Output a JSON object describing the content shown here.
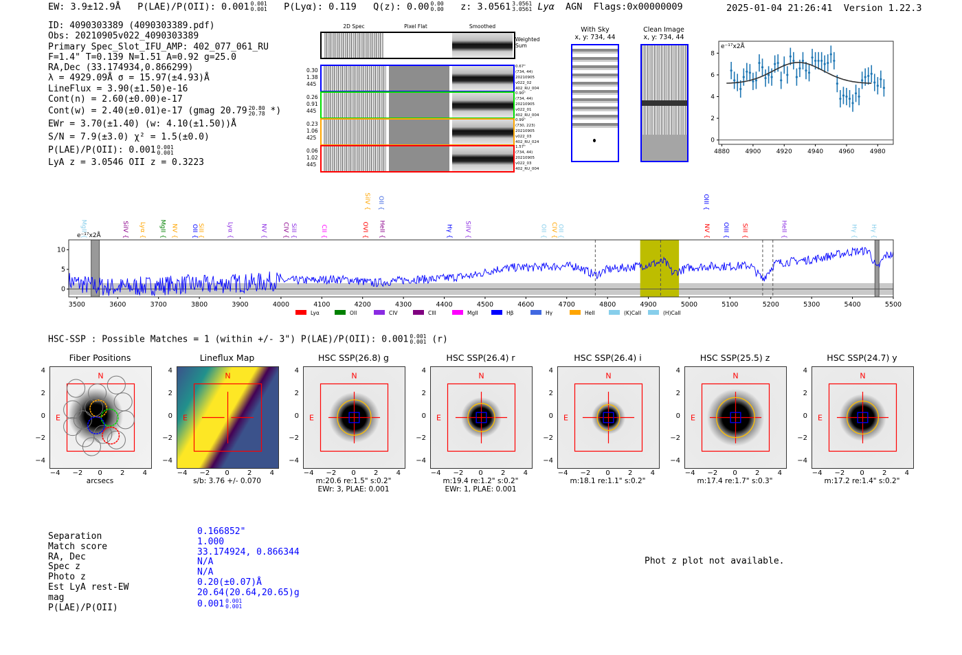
{
  "header": {
    "ew": "EW: 3.9±12.9Å",
    "plae_label": "P(LAE)/P(OII): 0.001",
    "plae_hi": "0.001",
    "plae_lo": "0.001",
    "plya": "P(Lyα): 0.119",
    "qz_label": "Q(z): 0.00",
    "qz_hi": "0.00",
    "qz_lo": "0.00",
    "z_label": "z: 3.0561",
    "z_hi": "3.0561",
    "z_lo": "3.0561",
    "line": "Lyα",
    "agn": "AGN",
    "flags": "Flags:0x00000009",
    "datetime": "2025-01-04 21:26:41",
    "version": "Version 1.22.3"
  },
  "info": {
    "lines": [
      "ID: 4090303389 (4090303389.pdf)",
      "Obs: 20210905v022_4090303389",
      "Primary Spec_Slot_IFU_AMP: 402_077_061_RU",
      "F=1.4\"  T=0.139  N=1.51  A=0.92  g=25.0",
      "RA,Dec (33.174934,0.866299)",
      "λ = 4929.09Å   σ = 15.97(±4.93)Å",
      "LineFlux = 3.90(±1.50)e-16",
      "Cont(n) = 2.60(±0.00)e-17"
    ],
    "contw": "Cont(w) = 2.40(±0.01)e-17 (gmag 20.79",
    "contw_hi": "20.80",
    "contw_lo": "20.78",
    "contw_end": "*)",
    "ewr": "EWr = 3.70(±1.40) (w: 4.10(±1.50))Å",
    "sn": "S/N = 7.9(±3.0)  χ² = 1.5(±0.0)",
    "plae": "P(LAE)/P(OII): 0.001",
    "plae_hi": "0.001",
    "plae_lo": "0.001",
    "z": "LyA z = 3.0546   OII z = 0.3223"
  },
  "spec2d": {
    "col_titles": [
      "2D Spec",
      "Pixel Flat",
      "Smoothed"
    ],
    "weighted_label": "Weighted Sum",
    "rows": [
      {
        "color": "#0000ff",
        "left": [
          "0.30",
          "1.38",
          "445"
        ],
        "right": [
          "0.67\"",
          "(734, 44)",
          "20210905",
          "v022_02",
          "402_RU_004"
        ]
      },
      {
        "color": "#00dd00",
        "left": [
          "0.26",
          "0.91",
          "445"
        ],
        "right": [
          "0.90\"",
          "(734, 44)",
          "20210905",
          "v022_01",
          "402_RU_004"
        ]
      },
      {
        "color": "#ffa500",
        "left": [
          "0.23",
          "1.06",
          "425"
        ],
        "right": [
          "0.99\"",
          "(730, 223)",
          "20210905",
          "v022_03",
          "402_RU_024"
        ]
      },
      {
        "color": "#ff0000",
        "left": [
          "0.06",
          "1.02",
          "445"
        ],
        "right": [
          "1.57\"",
          "(734, 44)",
          "20210905",
          "v022_03",
          "402_RU_004"
        ]
      }
    ]
  },
  "sky": {
    "title1": "With Sky",
    "coords1": "x, y: 734, 44",
    "title2": "Clean Image",
    "coords2": "x, y: 734, 44"
  },
  "chart_data": [
    {
      "type": "scatter",
      "unit_label": "e⁻¹⁷x2Å",
      "xlim": [
        4878,
        4990
      ],
      "ylim": [
        -0.4,
        9.1
      ],
      "xticks": [
        4880,
        4900,
        4920,
        4940,
        4960,
        4980
      ],
      "yticks": [
        0,
        2,
        4,
        6,
        8
      ],
      "x": [
        4886,
        4888,
        4890,
        4892,
        4894,
        4896,
        4898,
        4900,
        4902,
        4904,
        4906,
        4908,
        4910,
        4912,
        4914,
        4916,
        4918,
        4920,
        4922,
        4924,
        4926,
        4928,
        4930,
        4932,
        4934,
        4936,
        4938,
        4940,
        4942,
        4944,
        4946,
        4948,
        4950,
        4952,
        4954,
        4956,
        4958,
        4960,
        4962,
        4964,
        4966,
        4968,
        4970,
        4972,
        4974,
        4976,
        4978,
        4980,
        4982,
        4984
      ],
      "y": [
        6.4,
        5.5,
        5.3,
        4.7,
        5.8,
        6.3,
        6.2,
        5.4,
        5.5,
        7.1,
        6.7,
        5.7,
        6.0,
        5.8,
        7.0,
        7.1,
        5.5,
        6.9,
        6.0,
        7.7,
        7.3,
        5.8,
        6.6,
        7.3,
        6.4,
        6.2,
        7.6,
        7.3,
        7.3,
        7.3,
        7.0,
        7.1,
        7.9,
        7.3,
        5.2,
        3.8,
        4.1,
        4.0,
        3.8,
        3.4,
        4.3,
        4.0,
        5.5,
        5.8,
        5.9,
        6.1,
        5.3,
        5.0,
        5.6,
        4.8
      ],
      "yerr": 0.8,
      "fit": {
        "model": "gaussian",
        "center": 4929.09,
        "sigma": 15.97,
        "continuum": 5.2,
        "amplitude": 1.95,
        "range": [
          4883,
          4976
        ]
      },
      "colors": {
        "points": "#1f77b4",
        "fit": "#333333"
      }
    },
    {
      "type": "line",
      "unit_label": "e⁻¹⁷x2Å",
      "xlim": [
        3480,
        5500
      ],
      "ylim": [
        -2,
        12.5
      ],
      "xticks": [
        3500,
        3600,
        3700,
        3800,
        3900,
        4000,
        4100,
        4200,
        4300,
        4400,
        4500,
        4600,
        4700,
        4800,
        4900,
        5000,
        5100,
        5200,
        5300,
        5400,
        5500
      ],
      "yticks": [
        0,
        5,
        10
      ],
      "x": [
        3480,
        3525,
        3575,
        3625,
        3675,
        3725,
        3775,
        3825,
        3875,
        3925,
        3975,
        4025,
        4075,
        4125,
        4175,
        4225,
        4275,
        4325,
        4375,
        4425,
        4475,
        4525,
        4575,
        4625,
        4675,
        4725,
        4770,
        4800,
        4850,
        4900,
        4940,
        4960,
        5000,
        5050,
        5100,
        5150,
        5180,
        5210,
        5250,
        5300,
        5350,
        5400,
        5440,
        5460,
        5480,
        5500
      ],
      "y": [
        2,
        1,
        0.5,
        0.5,
        0.8,
        1,
        1.2,
        1,
        1.5,
        1.5,
        2,
        2.2,
        2.2,
        2.5,
        2.3,
        1.5,
        2,
        2.5,
        2.5,
        3,
        3.5,
        5,
        5.5,
        5.5,
        5.8,
        5.8,
        3.5,
        5,
        5.5,
        6.2,
        7,
        4,
        5.5,
        5.8,
        5.8,
        6,
        2.5,
        6.5,
        7,
        7.5,
        8.5,
        9.5,
        9.8,
        5,
        8.5,
        8.8
      ],
      "noise_band": 1.5,
      "highlight_range": [
        4880,
        4975
      ],
      "dashed_lines": [
        4770,
        4930,
        5180,
        5205
      ],
      "masked_ranges": [
        [
          3535,
          3555
        ],
        [
          5455,
          5465
        ]
      ],
      "colors": {
        "spectrum": "#0000ff",
        "highlight": "#bdbd00",
        "noise": "#bbbbbb"
      },
      "line_labels": [
        {
          "name": "MgII",
          "wave": 3508,
          "color": "#87ceeb",
          "row": 0
        },
        {
          "name": "SiIV",
          "wave": 3610,
          "color": "#8b008b",
          "row": 0
        },
        {
          "name": "Lyα",
          "wave": 3652,
          "color": "#ffa500",
          "row": 0
        },
        {
          "name": "MgII",
          "wave": 3701,
          "color": "#008000",
          "row": 0
        },
        {
          "name": "NV",
          "wave": 3730,
          "color": "#ffa500",
          "row": 0
        },
        {
          "name": "OII",
          "wave": 3780,
          "color": "#0000ff",
          "row": 0
        },
        {
          "name": "SiII",
          "wave": 3795,
          "color": "#ffa500",
          "row": 0
        },
        {
          "name": "Lyα",
          "wave": 3866,
          "color": "#8a2be2",
          "row": 0
        },
        {
          "name": "NV",
          "wave": 3949,
          "color": "#8a2be2",
          "row": 0
        },
        {
          "name": "CIV",
          "wave": 4003,
          "color": "#8b008b",
          "row": 0
        },
        {
          "name": "SiII",
          "wave": 4022,
          "color": "#8a2be2",
          "row": 0
        },
        {
          "name": "CII",
          "wave": 4096,
          "color": "#ff00ff",
          "row": 0
        },
        {
          "name": "OVI",
          "wave": 4197,
          "color": "#ff0000",
          "row": 0
        },
        {
          "name": "HeII",
          "wave": 4238,
          "color": "#8b008b",
          "row": 0
        },
        {
          "name": "Hγ",
          "wave": 4403,
          "color": "#0000ff",
          "row": 0
        },
        {
          "name": "SiIV",
          "wave": 4449,
          "color": "#8a2be2",
          "row": 0
        },
        {
          "name": "OII",
          "wave": 4634,
          "color": "#87ceeb",
          "row": 0
        },
        {
          "name": "CIV",
          "wave": 4660,
          "color": "#ffa500",
          "row": 0
        },
        {
          "name": "OII",
          "wave": 4676,
          "color": "#87ceeb",
          "row": 0
        },
        {
          "name": "NV",
          "wave": 5034,
          "color": "#ff0000",
          "row": 0
        },
        {
          "name": "OIII",
          "wave": 5081,
          "color": "#0000ff",
          "row": 0
        },
        {
          "name": "SiII",
          "wave": 5127,
          "color": "#ff0000",
          "row": 0
        },
        {
          "name": "HeII",
          "wave": 5223,
          "color": "#8a2be2",
          "row": 0
        },
        {
          "name": "Hγ",
          "wave": 5395,
          "color": "#87ceeb",
          "row": 0
        },
        {
          "name": "Hγ",
          "wave": 5443,
          "color": "#87ceeb",
          "row": 0
        },
        {
          "name": "SiIV",
          "wave": 4202,
          "color": "#ffa500",
          "row": 1
        },
        {
          "name": "OII",
          "wave": 4236,
          "color": "#4169e1",
          "row": 1
        },
        {
          "name": "OIII",
          "wave": 5032,
          "color": "#0000ff",
          "row": 1
        }
      ],
      "legend": [
        {
          "name": "Lyα",
          "color": "#ff0000"
        },
        {
          "name": "OII",
          "color": "#008000"
        },
        {
          "name": "CIV",
          "color": "#8a2be2"
        },
        {
          "name": "CIII",
          "color": "#800080"
        },
        {
          "name": "MgII",
          "color": "#ff00ff"
        },
        {
          "name": "Hβ",
          "color": "#0000ff"
        },
        {
          "name": "Hγ",
          "color": "#4169e1"
        },
        {
          "name": "HeII",
          "color": "#ffa500"
        },
        {
          "name": "(K)CaII",
          "color": "#87ceeb"
        },
        {
          "name": "(H)CaII",
          "color": "#87ceeb"
        }
      ],
      "legend_position": "bottom"
    }
  ],
  "hsc": {
    "summary": "HSC-SSP : Possible Matches = 1 (within +/- 3\")  P(LAE)/P(OII): 0.001",
    "summary_hi": "0.001",
    "summary_lo": "0.001",
    "summary_end": "(r)",
    "compass_n": "N",
    "compass_e": "E",
    "ticks": [
      "4",
      "2",
      "0",
      "−2",
      "−4"
    ],
    "xticks": [
      "−4",
      "−2",
      "0",
      "2",
      "4"
    ],
    "panels": [
      {
        "title": "Fiber Positions",
        "kind": "fibers",
        "caption": [
          "arcsecs"
        ]
      },
      {
        "title": "Lineflux Map",
        "kind": "lineflux",
        "caption": [
          "s/b: 3.76 +/- 0.070"
        ]
      },
      {
        "title": "HSC SSP(26.8) g",
        "kind": "image",
        "caption": [
          "m:20.6  re:1.5\"  s:0.2\"",
          "EWr: 3, PLAE: 0.001"
        ],
        "ellipse": [
          1.5,
          1.5
        ]
      },
      {
        "title": "HSC SSP(26.4) r",
        "kind": "image",
        "caption": [
          "m:19.4  re:1.2\"  s:0.2\"",
          "EWr: 1, PLAE: 0.001"
        ],
        "ellipse": [
          1.2,
          1.2
        ]
      },
      {
        "title": "HSC SSP(26.4) i",
        "kind": "image",
        "caption": [
          "m:18.1  re:1.1\"  s:0.2\""
        ],
        "ellipse": [
          1.0,
          1.1
        ]
      },
      {
        "title": "HSC SSP(25.5) z",
        "kind": "image",
        "caption": [
          "m:17.4  re:1.7\"  s:0.3\""
        ],
        "ellipse": [
          1.7,
          1.7
        ]
      },
      {
        "title": "HSC SSP(24.7) y",
        "kind": "image",
        "caption": [
          "m:17.2  re:1.4\"  s:0.2\""
        ],
        "ellipse": [
          1.4,
          1.4
        ]
      }
    ]
  },
  "match_table": {
    "labels": [
      "Separation",
      "Match score",
      "RA, Dec",
      "Spec z",
      "Photo z",
      "Est LyA rest-EW",
      "mag",
      "P(LAE)/P(OII)"
    ],
    "values": [
      "0.166852\"",
      "1.000",
      "33.174924, 0.866344",
      "N/A",
      "N/A",
      "0.20(±0.07)Å",
      "20.64(20.64,20.65)g",
      "0.001"
    ],
    "plae_hi": "0.001",
    "plae_lo": "0.001",
    "value_color": "#0000ff"
  },
  "photz_message": "Phot z plot not available."
}
